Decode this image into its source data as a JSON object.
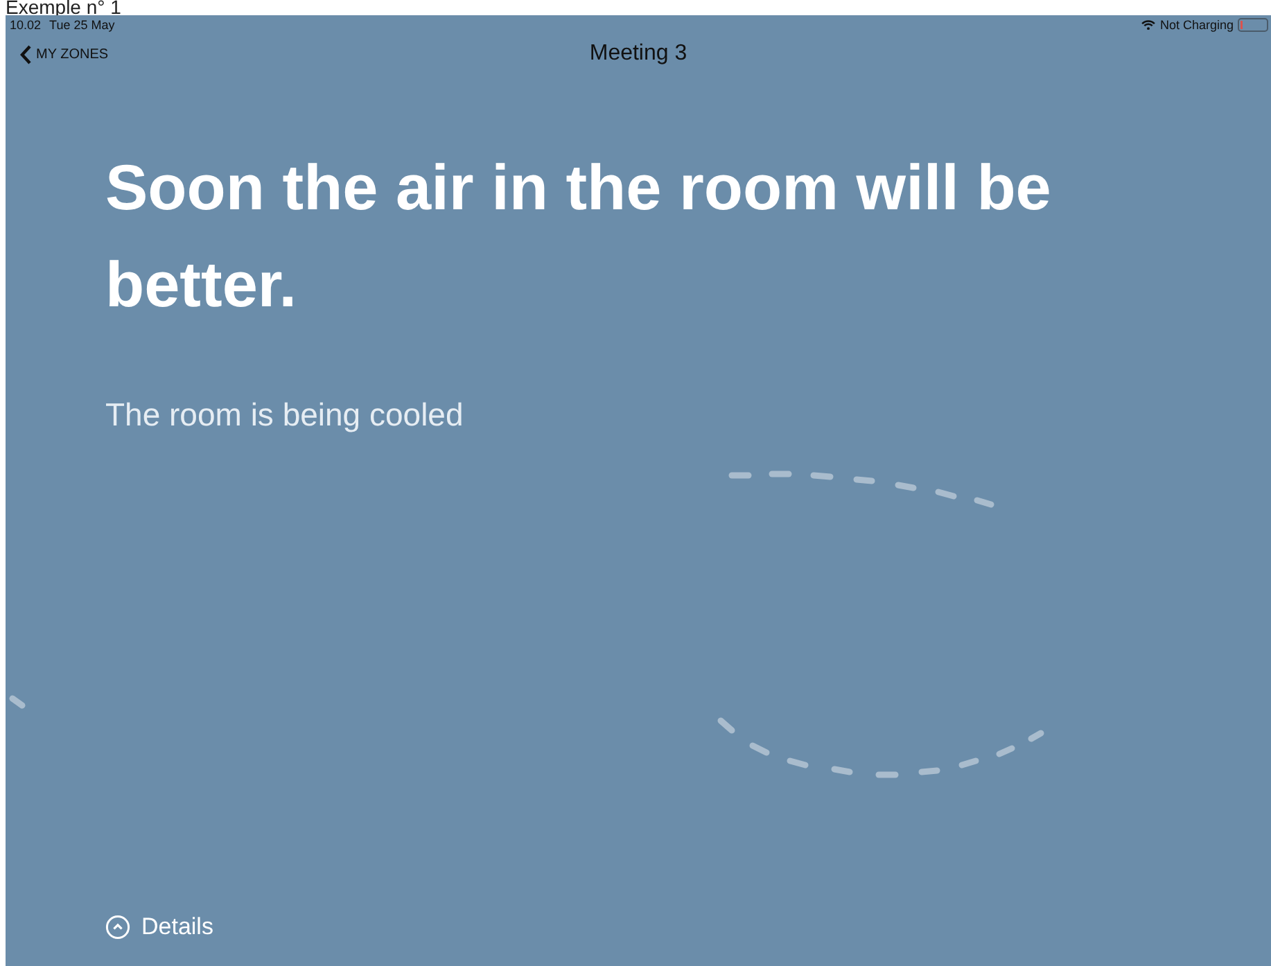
{
  "caption": "Exemple n° 1",
  "status_bar": {
    "time": "10.02",
    "date": "Tue 25 May",
    "charging_status": "Not Charging"
  },
  "nav": {
    "back_label": "MY ZONES",
    "title": "Meeting 3"
  },
  "headline": "Soon the air in the room will be better.",
  "status_text": "The room is being cooled",
  "details_button": {
    "label": "Details"
  }
}
